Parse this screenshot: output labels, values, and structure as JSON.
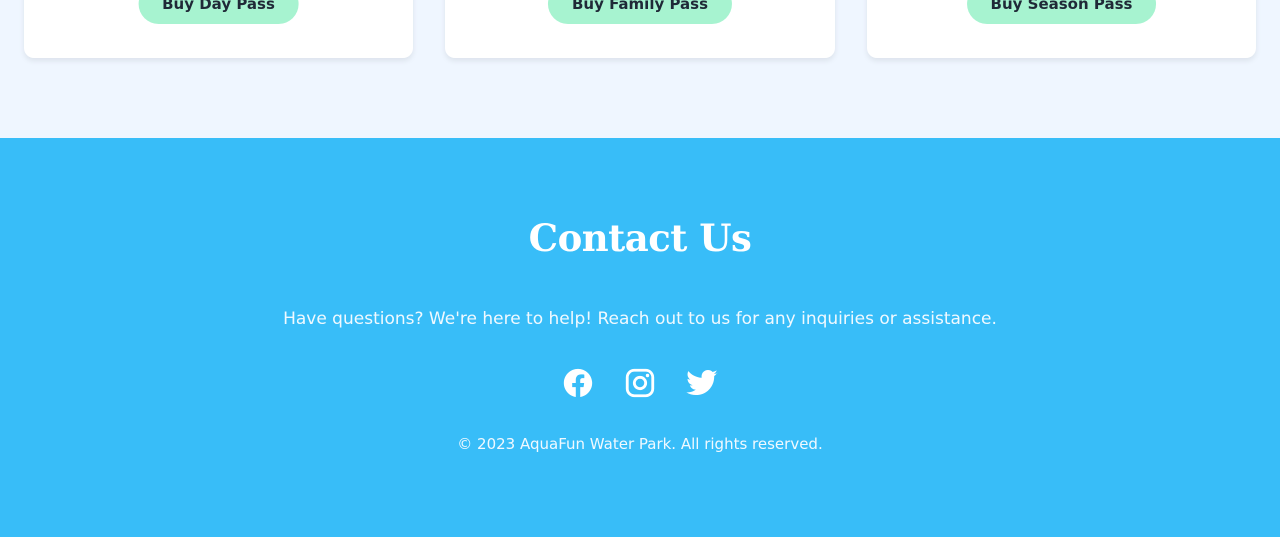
{
  "passes": [
    {
      "button_label": "Buy Day Pass"
    },
    {
      "button_label": "Buy Family Pass"
    },
    {
      "button_label": "Buy Season Pass"
    }
  ],
  "contact": {
    "title": "Contact Us",
    "description": "Have questions? We're here to help! Reach out to us for any inquiries or assistance.",
    "socials": [
      {
        "icon": "facebook-icon"
      },
      {
        "icon": "instagram-icon"
      },
      {
        "icon": "twitter-icon"
      }
    ],
    "copyright": "© 2023 AquaFun Water Park. All rights reserved."
  },
  "colors": {
    "accent": "#38bdf8",
    "button_bg": "#a7f3d0",
    "page_bg": "#eff6ff"
  }
}
